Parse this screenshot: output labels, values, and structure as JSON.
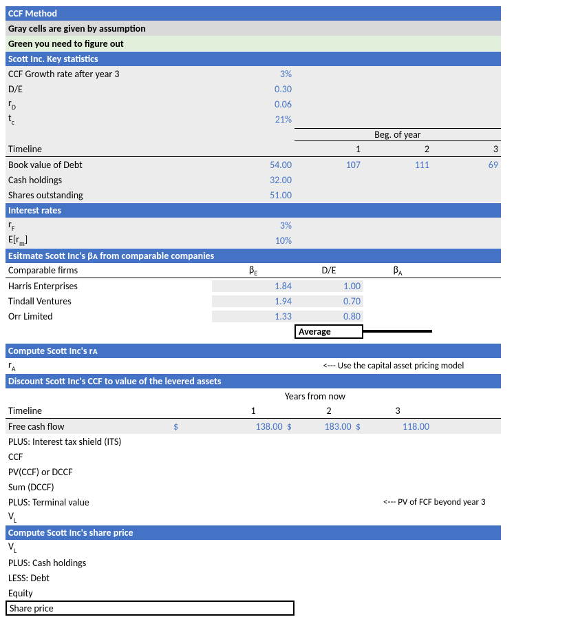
{
  "bands": {
    "ccf_method": "CCF Method",
    "gray_note": "Gray cells are given by assumption",
    "green_note": "Green you need to figure out",
    "key_stats": "Scott Inc. Key statistics",
    "interest_rates": "Interest rates",
    "estimate_beta": "Esitmate Scott Inc's βᴀ from comparable companies",
    "compute_ra": "Compute Scott Inc's rᴀ",
    "discount_ccf": "Discount Scott Inc's CCF to value of the levered assets",
    "compute_share": "Compute Scott Inc's share price"
  },
  "key_stats": {
    "growth_label": "CCF Growth rate after year 3",
    "growth_val": "3%",
    "de_label": "D/E",
    "de_val": "0.30",
    "rd_label_main": "r",
    "rd_label_sub": "D",
    "rd_val": "0.06",
    "tc_label_main": "t",
    "tc_label_sub": "c",
    "tc_val": "21%",
    "beg_of_year": "Beg. of year",
    "timeline_label": "Timeline",
    "years": {
      "y1": "1",
      "y2": "2",
      "y3": "3"
    },
    "bv_debt_label": "Book value of Debt",
    "bv_debt_v0": "54.00",
    "bv_debt_v1": "107",
    "bv_debt_v2": "111",
    "bv_debt_v3": "69",
    "cash_label": "Cash holdings",
    "cash_val": "32.00",
    "shares_label": "Shares outstanding",
    "shares_val": "51.00"
  },
  "interest": {
    "rf_main": "r",
    "rf_sub": "F",
    "rf_val": "3%",
    "erm_label": "E[r",
    "erm_sub": "m",
    "erm_close": "]",
    "erm_val": "10%"
  },
  "comps": {
    "hdr_firms": "Comparable firms",
    "hdr_be": "β",
    "hdr_be_sub": "E",
    "hdr_de": "D/E",
    "hdr_ba": "β",
    "hdr_ba_sub": "A",
    "rows": [
      {
        "name": "Harris Enterprises",
        "be": "1.84",
        "de": "1.00"
      },
      {
        "name": "Tindall Ventures",
        "be": "1.94",
        "de": "0.70"
      },
      {
        "name": "Orr Limited",
        "be": "1.33",
        "de": "0.80"
      }
    ],
    "average_label": "Average"
  },
  "ra_section": {
    "ra_main": "r",
    "ra_sub": "A",
    "annotation": "<--- Use the capital asset pricing model"
  },
  "ccf": {
    "years_from_now": "Years from now",
    "timeline_label": "Timeline",
    "y1": "1",
    "y2": "2",
    "y3": "3",
    "fcf_label": "Free cash flow",
    "dollar": "$",
    "fcf_v1": "138.00",
    "fcf_v2": "183.00",
    "fcf_v3": "118.00",
    "its_label": "PLUS: Interest tax shield (ITS)",
    "ccf_label": "CCF",
    "pv_label": "PV(CCF) or DCCF",
    "sum_label": "Sum (DCCF)",
    "tv_label": "PLUS: Terminal value",
    "tv_annotation": "<--- PV of FCF beyond year 3",
    "vl_label_main": "V",
    "vl_label_sub": "L"
  },
  "share": {
    "vl_main": "V",
    "vl_sub": "L",
    "plus_cash": "PLUS: Cash holdings",
    "less_debt": "LESS: Debt",
    "equity": "Equity",
    "share_price": "Share price"
  }
}
